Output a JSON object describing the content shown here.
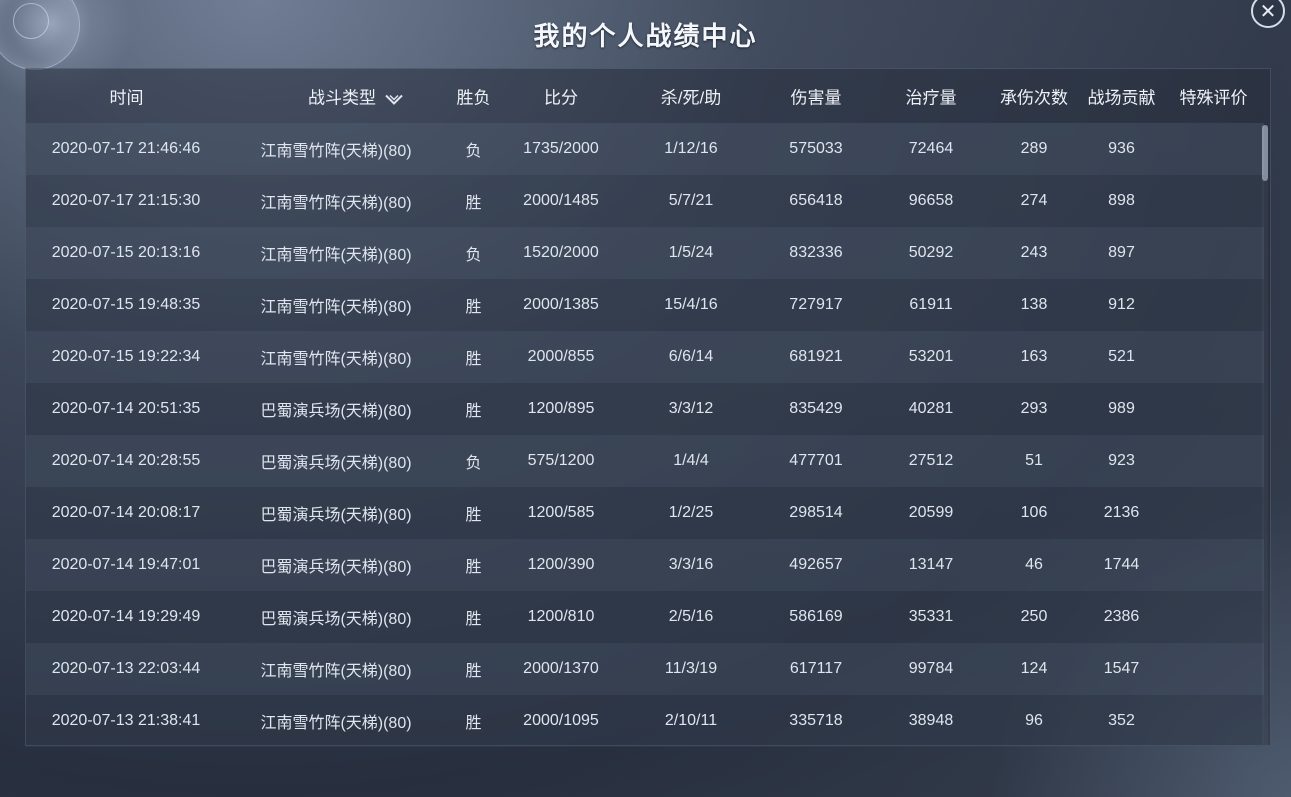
{
  "window": {
    "title": "我的个人战绩中心",
    "close_glyph": "✕"
  },
  "table": {
    "headers": {
      "time": "时间",
      "battle_type": "战斗类型",
      "result": "胜负",
      "score": "比分",
      "kda": "杀/死/助",
      "damage": "伤害量",
      "healing": "治疗量",
      "hits_taken": "承伤次数",
      "contribution": "战场贡献",
      "special": "特殊评价"
    },
    "rows": [
      {
        "time": "2020-07-17 21:46:46",
        "battle_type": "江南雪竹阵(天梯)(80)",
        "result": "负",
        "score": "1735/2000",
        "kda": "1/12/16",
        "damage": "575033",
        "healing": "72464",
        "hits_taken": "289",
        "contribution": "936",
        "special": ""
      },
      {
        "time": "2020-07-17 21:15:30",
        "battle_type": "江南雪竹阵(天梯)(80)",
        "result": "胜",
        "score": "2000/1485",
        "kda": "5/7/21",
        "damage": "656418",
        "healing": "96658",
        "hits_taken": "274",
        "contribution": "898",
        "special": ""
      },
      {
        "time": "2020-07-15 20:13:16",
        "battle_type": "江南雪竹阵(天梯)(80)",
        "result": "负",
        "score": "1520/2000",
        "kda": "1/5/24",
        "damage": "832336",
        "healing": "50292",
        "hits_taken": "243",
        "contribution": "897",
        "special": ""
      },
      {
        "time": "2020-07-15 19:48:35",
        "battle_type": "江南雪竹阵(天梯)(80)",
        "result": "胜",
        "score": "2000/1385",
        "kda": "15/4/16",
        "damage": "727917",
        "healing": "61911",
        "hits_taken": "138",
        "contribution": "912",
        "special": ""
      },
      {
        "time": "2020-07-15 19:22:34",
        "battle_type": "江南雪竹阵(天梯)(80)",
        "result": "胜",
        "score": "2000/855",
        "kda": "6/6/14",
        "damage": "681921",
        "healing": "53201",
        "hits_taken": "163",
        "contribution": "521",
        "special": ""
      },
      {
        "time": "2020-07-14 20:51:35",
        "battle_type": "巴蜀演兵场(天梯)(80)",
        "result": "胜",
        "score": "1200/895",
        "kda": "3/3/12",
        "damage": "835429",
        "healing": "40281",
        "hits_taken": "293",
        "contribution": "989",
        "special": ""
      },
      {
        "time": "2020-07-14 20:28:55",
        "battle_type": "巴蜀演兵场(天梯)(80)",
        "result": "负",
        "score": "575/1200",
        "kda": "1/4/4",
        "damage": "477701",
        "healing": "27512",
        "hits_taken": "51",
        "contribution": "923",
        "special": ""
      },
      {
        "time": "2020-07-14 20:08:17",
        "battle_type": "巴蜀演兵场(天梯)(80)",
        "result": "胜",
        "score": "1200/585",
        "kda": "1/2/25",
        "damage": "298514",
        "healing": "20599",
        "hits_taken": "106",
        "contribution": "2136",
        "special": ""
      },
      {
        "time": "2020-07-14 19:47:01",
        "battle_type": "巴蜀演兵场(天梯)(80)",
        "result": "胜",
        "score": "1200/390",
        "kda": "3/3/16",
        "damage": "492657",
        "healing": "13147",
        "hits_taken": "46",
        "contribution": "1744",
        "special": ""
      },
      {
        "time": "2020-07-14 19:29:49",
        "battle_type": "巴蜀演兵场(天梯)(80)",
        "result": "胜",
        "score": "1200/810",
        "kda": "2/5/16",
        "damage": "586169",
        "healing": "35331",
        "hits_taken": "250",
        "contribution": "2386",
        "special": ""
      },
      {
        "time": "2020-07-13 22:03:44",
        "battle_type": "江南雪竹阵(天梯)(80)",
        "result": "胜",
        "score": "2000/1370",
        "kda": "11/3/19",
        "damage": "617117",
        "healing": "99784",
        "hits_taken": "124",
        "contribution": "1547",
        "special": ""
      },
      {
        "time": "2020-07-13 21:38:41",
        "battle_type": "江南雪竹阵(天梯)(80)",
        "result": "胜",
        "score": "2000/1095",
        "kda": "2/10/11",
        "damage": "335718",
        "healing": "38948",
        "hits_taken": "96",
        "contribution": "352",
        "special": ""
      }
    ]
  }
}
